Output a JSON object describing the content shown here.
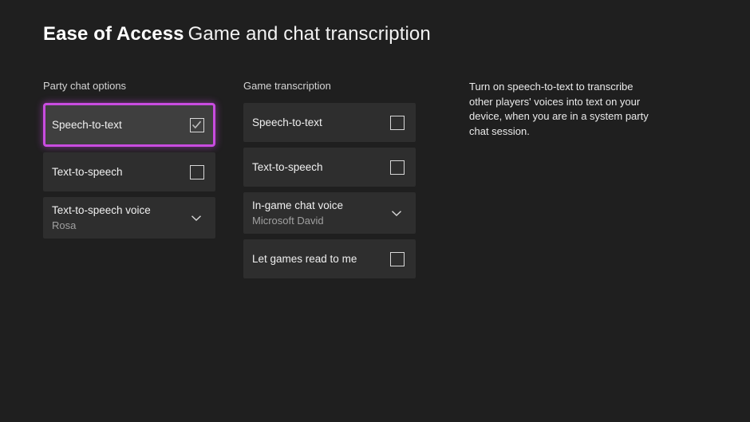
{
  "header": {
    "breadcrumb_primary": "Ease of Access",
    "breadcrumb_secondary": "Game and chat transcription"
  },
  "accent_color": "#c94ce0",
  "page_background": "#1f1f1f",
  "card_background": "#2e2e2e",
  "card_focused_background": "#3f3f3f",
  "party_chat": {
    "section_label": "Party chat options",
    "items": [
      {
        "label": "Speech-to-text",
        "control": "checkbox",
        "checked": true,
        "focused": true,
        "icon": "checkbox-checked-icon"
      },
      {
        "label": "Text-to-speech",
        "control": "checkbox",
        "checked": false,
        "focused": false,
        "icon": "checkbox-unchecked-icon"
      },
      {
        "label": "Text-to-speech voice",
        "control": "dropdown",
        "value": "Rosa",
        "focused": false,
        "icon": "chevron-down-icon"
      }
    ]
  },
  "game_transcription": {
    "section_label": "Game transcription",
    "items": [
      {
        "label": "Speech-to-text",
        "control": "checkbox",
        "checked": false,
        "focused": false,
        "icon": "checkbox-unchecked-icon"
      },
      {
        "label": "Text-to-speech",
        "control": "checkbox",
        "checked": false,
        "focused": false,
        "icon": "checkbox-unchecked-icon"
      },
      {
        "label": "In-game chat voice",
        "control": "dropdown",
        "value": "Microsoft David",
        "focused": false,
        "icon": "chevron-down-icon"
      },
      {
        "label": "Let games read to me",
        "control": "checkbox",
        "checked": false,
        "focused": false,
        "icon": "checkbox-unchecked-icon"
      }
    ]
  },
  "description": {
    "text": "Turn on speech-to-text to transcribe other players' voices into text on your device, when you are in a system party chat session."
  }
}
